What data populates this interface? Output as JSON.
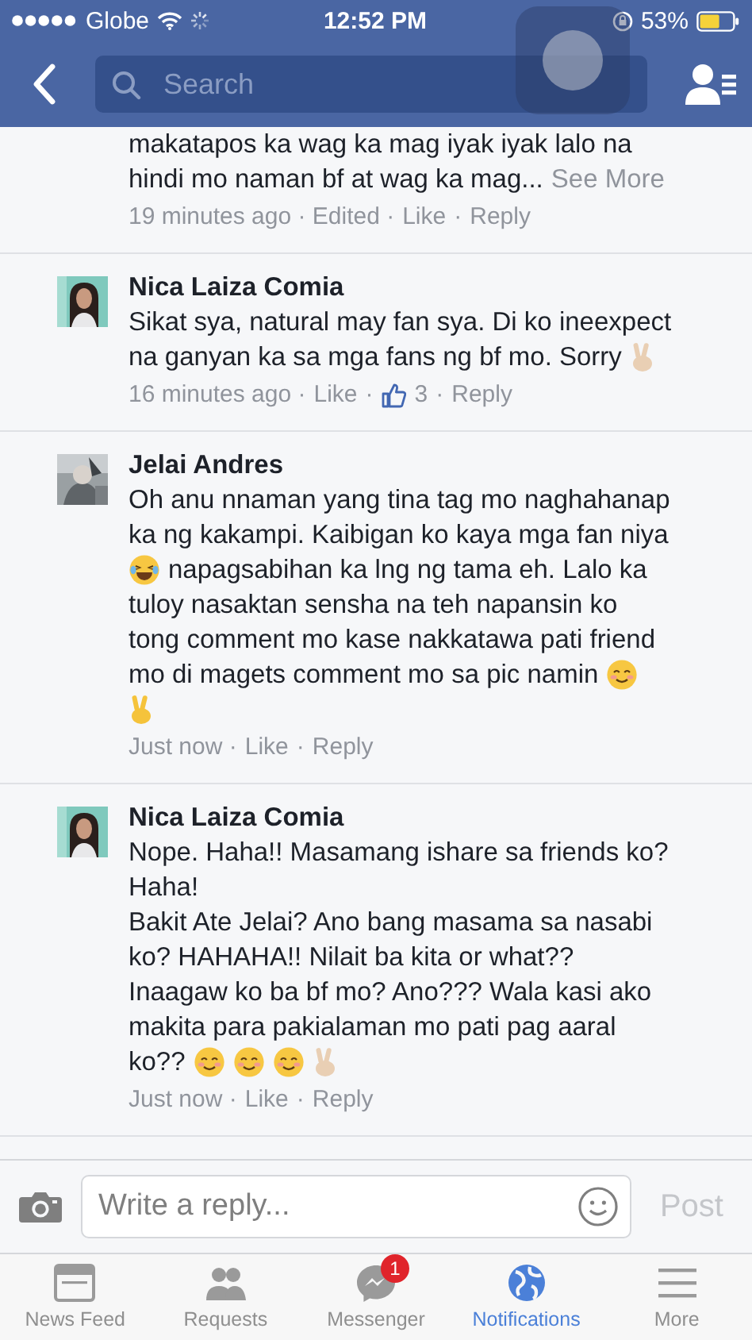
{
  "status_bar": {
    "carrier": "Globe",
    "time": "12:52 PM",
    "battery": "53%"
  },
  "nav": {
    "search": {
      "placeholder": "Search"
    }
  },
  "comments": [
    {
      "lines": [
        [
          {
            "kind": "text",
            "text": "makatapos ka wag ka mag iyak iyak lalo na"
          }
        ],
        [
          {
            "kind": "text",
            "text": "hindi mo naman bf at wag ka mag..."
          },
          {
            "kind": "see-more",
            "text": "See More"
          }
        ]
      ],
      "meta": [
        {
          "kind": "text",
          "text": "19 minutes ago · Edited ·"
        },
        {
          "kind": "like",
          "text": "Like"
        },
        {
          "kind": "text",
          "text": "·"
        },
        {
          "kind": "reply",
          "text": "Reply"
        }
      ]
    },
    {
      "author": "Nica Laiza Comia",
      "lines": [
        [
          {
            "kind": "text",
            "text": "Sikat sya, natural may fan sya. Di ko ineexpect"
          }
        ],
        [
          {
            "kind": "text",
            "text": "na ganyan ka sa mga fans ng bf mo. Sorry"
          },
          {
            "kind": "peace-light"
          }
        ]
      ],
      "meta": [
        {
          "kind": "text",
          "text": "16 minutes ago ·"
        },
        {
          "kind": "like",
          "text": "Like"
        },
        {
          "kind": "text",
          "text": "·"
        },
        {
          "kind": "reactions",
          "text": "3"
        },
        {
          "kind": "text",
          "text": "·"
        },
        {
          "kind": "reply",
          "text": "Reply"
        }
      ]
    },
    {
      "author": "Jelai Andres",
      "lines": [
        [
          {
            "kind": "text",
            "text": "Oh anu nnaman yang tina tag mo naghahanap"
          }
        ],
        [
          {
            "kind": "text",
            "text": "ka ng kakampi. Kaibigan ko kaya mga fan niya"
          }
        ],
        [
          {
            "kind": "laughing"
          },
          {
            "kind": "text",
            "text": "napagsabihan ka lng ng tama eh. Lalo ka"
          }
        ],
        [
          {
            "kind": "text",
            "text": "tuloy nasaktan sensha na teh napansin ko"
          }
        ],
        [
          {
            "kind": "text",
            "text": "tong comment mo kase nakkatawa pati friend"
          }
        ],
        [
          {
            "kind": "text",
            "text": "mo di magets comment mo sa pic namin"
          },
          {
            "kind": "blush"
          }
        ],
        [
          {
            "kind": "peace-yellow"
          }
        ]
      ],
      "meta": [
        {
          "kind": "text",
          "text": "Just now ·"
        },
        {
          "kind": "like",
          "text": "Like"
        },
        {
          "kind": "text",
          "text": "·"
        },
        {
          "kind": "reply",
          "text": "Reply"
        }
      ]
    },
    {
      "author": "Nica Laiza Comia",
      "lines": [
        [
          {
            "kind": "text",
            "text": "Nope. Haha!! Masamang ishare sa friends ko?"
          }
        ],
        [
          {
            "kind": "text",
            "text": "Haha!"
          }
        ],
        [
          {
            "kind": "text",
            "text": "Bakit Ate Jelai? Ano bang masama sa nasabi"
          }
        ],
        [
          {
            "kind": "text",
            "text": "ko? HAHAHA!! Nilait ba kita or what??"
          }
        ],
        [
          {
            "kind": "text",
            "text": "Inaagaw ko ba bf mo? Ano??? Wala kasi ako"
          }
        ],
        [
          {
            "kind": "text",
            "text": "makita para pakialaman mo pati pag aaral"
          }
        ],
        [
          {
            "kind": "text",
            "text": "ko??"
          },
          {
            "kind": "smiling"
          },
          {
            "kind": "smiling"
          },
          {
            "kind": "smiling"
          },
          {
            "kind": "peace-light"
          }
        ]
      ],
      "meta": [
        {
          "kind": "text",
          "text": "Just now ·"
        },
        {
          "kind": "like",
          "text": "Like"
        },
        {
          "kind": "text",
          "text": "·"
        },
        {
          "kind": "reply",
          "text": "Reply"
        }
      ]
    }
  ],
  "reply_bar": {
    "placeholder": "Write a reply...",
    "post": "Post",
    "post_disabled": true
  },
  "tabs": [
    {
      "kind": "feed",
      "label": "News Feed",
      "selected": false
    },
    {
      "kind": "requests",
      "label": "Requests",
      "selected": false
    },
    {
      "kind": "messenger",
      "label": "Messenger",
      "selected": false,
      "badge": "1"
    },
    {
      "kind": "notifications",
      "label": "Notifications",
      "selected": true
    },
    {
      "kind": "more",
      "label": "More",
      "selected": false
    }
  ]
}
